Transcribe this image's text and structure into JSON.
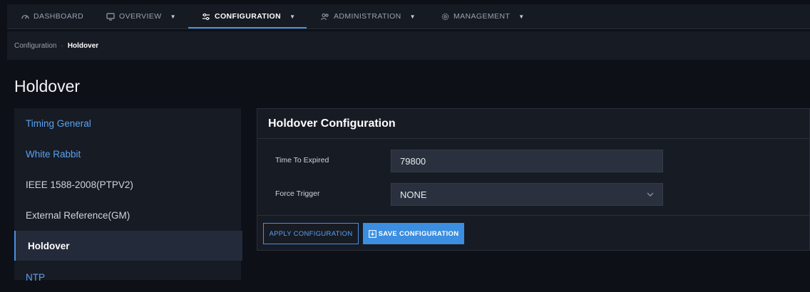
{
  "nav": {
    "items": [
      {
        "label": "DASHBOARD",
        "icon": "dashboard-icon",
        "has_dropdown": false
      },
      {
        "label": "OVERVIEW",
        "icon": "monitor-icon",
        "has_dropdown": true
      },
      {
        "label": "CONFIGURATION",
        "icon": "sliders-icon",
        "has_dropdown": true,
        "active": true
      },
      {
        "label": "ADMINISTRATION",
        "icon": "users-icon",
        "has_dropdown": true
      },
      {
        "label": "MANAGEMENT",
        "icon": "gear-icon",
        "has_dropdown": true
      }
    ]
  },
  "breadcrumb": {
    "parent": "Configuration",
    "separator": "·",
    "current": "Holdover"
  },
  "page": {
    "title": "Holdover"
  },
  "sidebar": {
    "items": [
      {
        "label": "Timing General"
      },
      {
        "label": "White Rabbit"
      },
      {
        "label": "IEEE 1588-2008(PTPV2)"
      },
      {
        "label": "External Reference(GM)"
      },
      {
        "label": "Holdover",
        "active": true
      },
      {
        "label": "NTP"
      }
    ]
  },
  "panel": {
    "title": "Holdover Configuration",
    "fields": {
      "time_to_expired": {
        "label": "Time To Expired",
        "value": "79800"
      },
      "force_trigger": {
        "label": "Force Trigger",
        "value": "NONE"
      }
    },
    "buttons": {
      "apply": "APPLY CONFIGURATION",
      "save": "SAVE CONFIGURATION"
    }
  },
  "colors": {
    "accent": "#4a90e2",
    "background": "#0d1017",
    "panel": "#171b24",
    "save_button": "#3b8ee0"
  }
}
